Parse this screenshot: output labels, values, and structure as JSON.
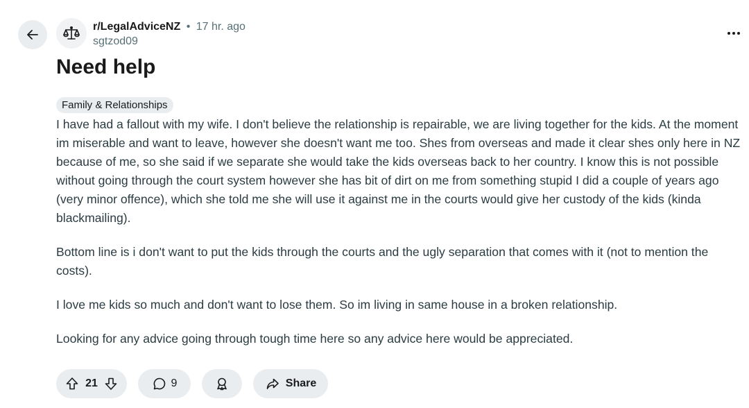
{
  "header": {
    "subreddit": "r/LegalAdviceNZ",
    "separator": "•",
    "time": "17 hr. ago",
    "author": "sgtzod09",
    "icons": {
      "back": "arrow-left-icon",
      "subreddit_avatar": "scales-of-justice-icon",
      "more": "ellipsis-icon"
    }
  },
  "post": {
    "title": "Need help",
    "flair": "Family & Relationships",
    "paragraphs": [
      "I have had a fallout with my wife. I don't believe the relationship is repairable, we are living together for the kids. At the moment im miserable and want to leave, however she doesn't want me too. Shes from overseas and made it clear shes only here in NZ because of me, so she said if we separate she would take the kids overseas back to her country. I know this is not possible without going through the court system however she has bit of dirt on me from something stupid I did a couple of years ago (very minor offence), which she told me she will use it against me in the courts would give her custody of the kids (kinda blackmailing).",
      "Bottom line is i don't want to put the kids through the courts and the ugly separation that comes with it (not to mention the costs).",
      "I love me kids so much and don't want to lose them. So im living in same house in a broken relationship.",
      "Looking for any advice going through tough time here so any advice here would be appreciated."
    ]
  },
  "actions": {
    "votes": "21",
    "comments": "9",
    "share_label": "Share",
    "icons": {
      "upvote": "upvote-arrow-icon",
      "downvote": "downvote-arrow-icon",
      "comment": "comment-bubble-icon",
      "award": "award-icon",
      "share": "share-arrow-icon"
    }
  },
  "colors": {
    "pill_background": "#eaedef",
    "meta_text": "#576f76",
    "body_text": "#2a3c42"
  }
}
